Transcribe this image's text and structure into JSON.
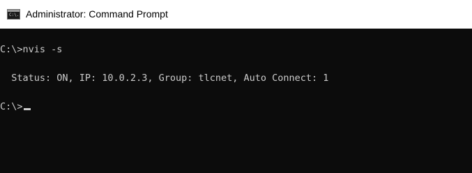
{
  "window": {
    "title": "Administrator: Command Prompt",
    "icon": "cmd-icon",
    "icon_glyph": "C:\\."
  },
  "console": {
    "lines": [
      "C:\\>nvis -s",
      "  Status: ON, IP: 10.0.2.3, Group: tlcnet, Auto Connect: 1",
      "C:\\>"
    ],
    "cursor": "underscore"
  },
  "colors": {
    "background": "#0c0c0c",
    "text": "#cccccc",
    "titlebar": "#ffffff"
  }
}
